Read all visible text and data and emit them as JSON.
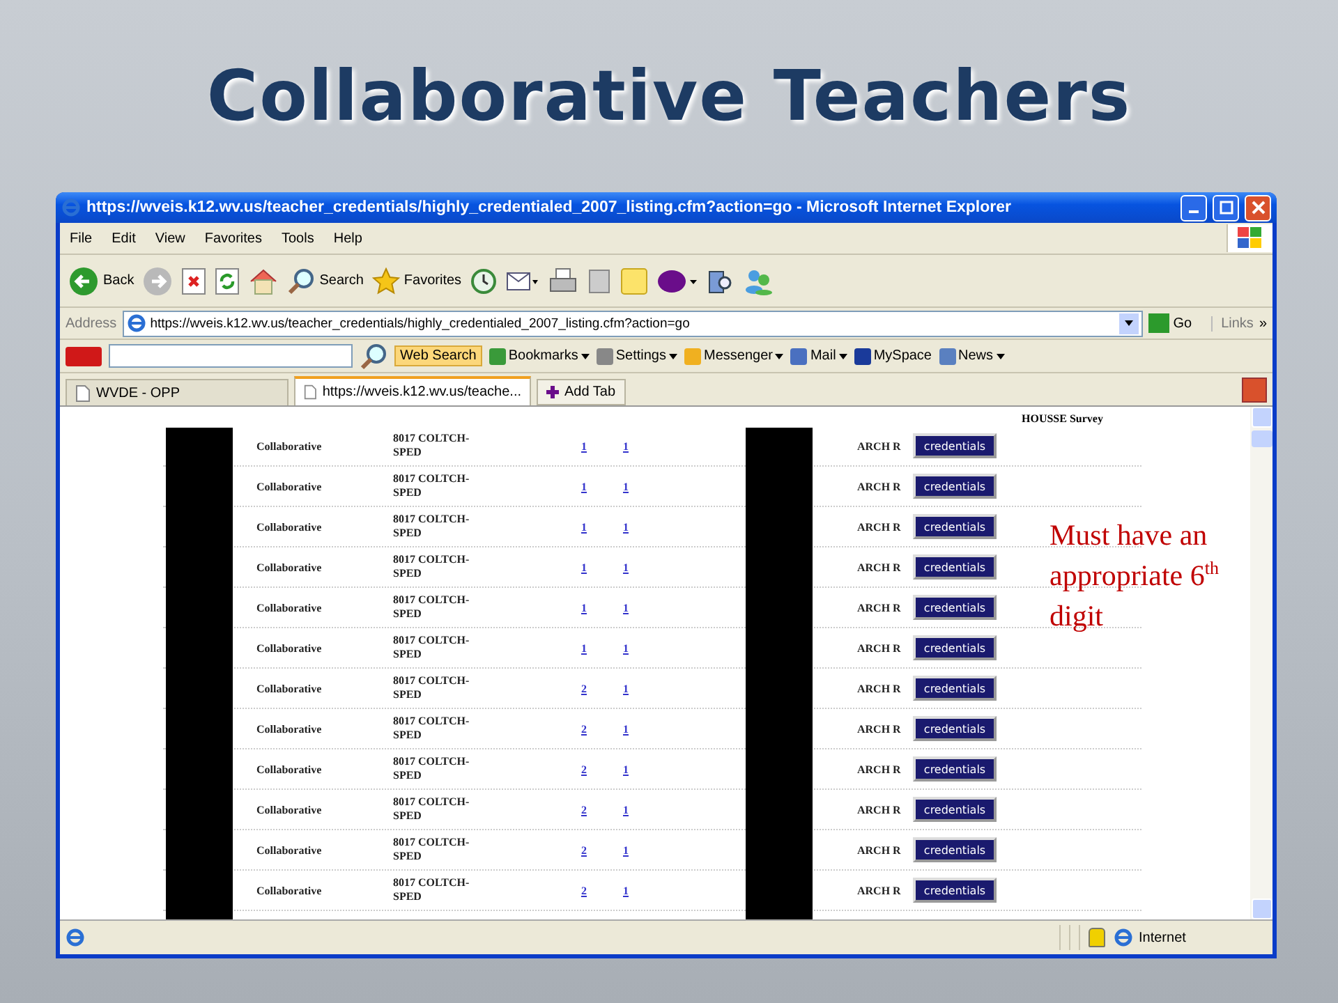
{
  "slide": {
    "title": "Collaborative Teachers",
    "annotation": "Must have an appropriate 6$^{th}$ digit"
  },
  "window": {
    "title": "https://wveis.k12.wv.us/teacher_credentials/highly_credentialed_2007_listing.cfm?action=go - Microsoft Internet Explorer"
  },
  "menu": [
    "File",
    "Edit",
    "View",
    "Favorites",
    "Tools",
    "Help"
  ],
  "toolbar": [
    {
      "kind": "back",
      "label": "Back"
    },
    {
      "kind": "forward"
    },
    {
      "kind": "stop"
    },
    {
      "kind": "refresh"
    },
    {
      "kind": "home"
    },
    {
      "kind": "search",
      "label": "Search"
    },
    {
      "kind": "favorites",
      "label": "Favorites"
    },
    {
      "kind": "history"
    },
    {
      "kind": "mail"
    },
    {
      "kind": "print"
    },
    {
      "kind": "edit"
    },
    {
      "kind": "note"
    },
    {
      "kind": "yahoo"
    },
    {
      "kind": "research"
    },
    {
      "kind": "messenger"
    }
  ],
  "address": {
    "label": "Address",
    "value": "https://wveis.k12.wv.us/teacher_credentials/highly_credentialed_2007_listing.cfm?action=go",
    "go": "Go",
    "links": "Links",
    "links_chevron": "»"
  },
  "yahoo_toolbar": {
    "search_button": "Web Search",
    "items": [
      {
        "label": "Bookmarks",
        "dropdown": true
      },
      {
        "label": "Settings",
        "dropdown": true
      },
      {
        "label": "Messenger",
        "dropdown": true
      },
      {
        "label": "Mail",
        "dropdown": true
      },
      {
        "label": "MySpace",
        "dropdown": false
      },
      {
        "label": "News",
        "dropdown": true
      }
    ]
  },
  "tabs": [
    {
      "label": "WVDE - OPP",
      "selected": false
    },
    {
      "label": "https://wveis.k12.wv.us/teache...",
      "selected": true
    }
  ],
  "add_tab": "Add Tab",
  "table": {
    "header_note": "HOUSSE Survey",
    "rows": [
      {
        "column_1": "Collaborative",
        "column_2": "8017 COLTCH-SPED",
        "column_3": "1",
        "column_4": "1",
        "column_5": "ARCH R",
        "action": "credentials"
      },
      {
        "column_1": "Collaborative",
        "column_2": "8017 COLTCH-SPED",
        "column_3": "1",
        "column_4": "1",
        "column_5": "ARCH R",
        "action": "credentials"
      },
      {
        "column_1": "Collaborative",
        "column_2": "8017 COLTCH-SPED",
        "column_3": "1",
        "column_4": "1",
        "column_5": "ARCH R",
        "action": "credentials"
      },
      {
        "column_1": "Collaborative",
        "column_2": "8017 COLTCH-SPED",
        "column_3": "1",
        "column_4": "1",
        "column_5": "ARCH R",
        "action": "credentials"
      },
      {
        "column_1": "Collaborative",
        "column_2": "8017 COLTCH-SPED",
        "column_3": "1",
        "column_4": "1",
        "column_5": "ARCH R",
        "action": "credentials"
      },
      {
        "column_1": "Collaborative",
        "column_2": "8017 COLTCH-SPED",
        "column_3": "1",
        "column_4": "1",
        "column_5": "ARCH R",
        "action": "credentials"
      },
      {
        "column_1": "Collaborative",
        "column_2": "8017 COLTCH-SPED",
        "column_3": "2",
        "column_4": "1",
        "column_5": "ARCH R",
        "action": "credentials"
      },
      {
        "column_1": "Collaborative",
        "column_2": "8017 COLTCH-SPED",
        "column_3": "2",
        "column_4": "1",
        "column_5": "ARCH R",
        "action": "credentials"
      },
      {
        "column_1": "Collaborative",
        "column_2": "8017 COLTCH-SPED",
        "column_3": "2",
        "column_4": "1",
        "column_5": "ARCH R",
        "action": "credentials"
      },
      {
        "column_1": "Collaborative",
        "column_2": "8017 COLTCH-SPED",
        "column_3": "2",
        "column_4": "1",
        "column_5": "ARCH R",
        "action": "credentials"
      },
      {
        "column_1": "Collaborative",
        "column_2": "8017 COLTCH-SPED",
        "column_3": "2",
        "column_4": "1",
        "column_5": "ARCH R",
        "action": "credentials"
      },
      {
        "column_1": "Collaborative",
        "column_2": "8017 COLTCH-SPED",
        "column_3": "2",
        "column_4": "1",
        "column_5": "ARCH R",
        "action": "credentials"
      }
    ]
  },
  "status_bar": {
    "zone": "Internet"
  }
}
